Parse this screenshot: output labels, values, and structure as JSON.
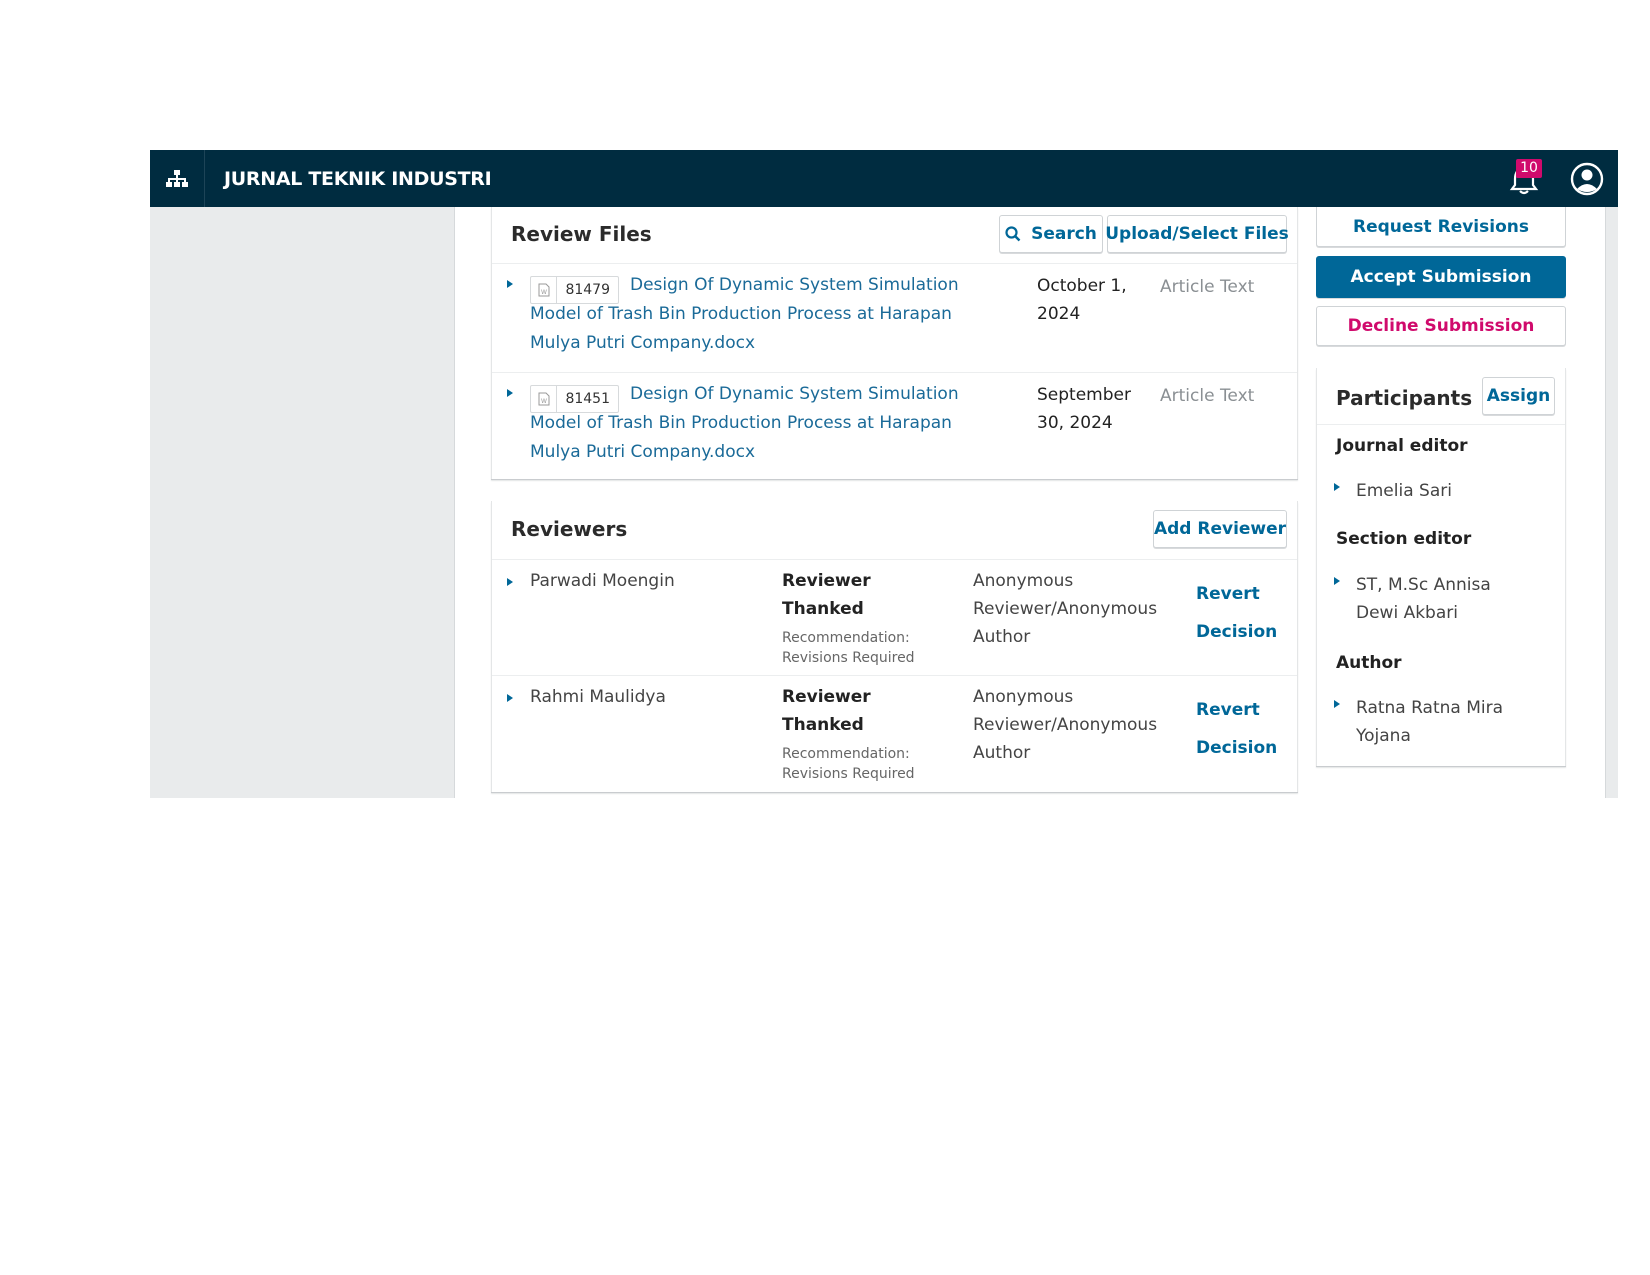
{
  "header": {
    "journal_title": "JURNAL TEKNIK INDUSTRI",
    "notification_count": "10"
  },
  "review_files": {
    "title": "Review Files",
    "search_label": "Search",
    "upload_label": "Upload/Select Files",
    "files": [
      {
        "id": "81479",
        "name": "Design Of Dynamic System Simulation Model of Trash Bin Production Process at Harapan Mulya Putri Company.docx",
        "date": "October 1, 2024",
        "type": "Article Text"
      },
      {
        "id": "81451",
        "name": "Design Of Dynamic System Simulation Model of Trash Bin Production Process at Harapan Mulya Putri Company.docx",
        "date": "September 30, 2024",
        "type": "Article Text"
      }
    ]
  },
  "reviewers": {
    "title": "Reviewers",
    "add_label": "Add Reviewer",
    "rows": [
      {
        "name": "Parwadi Moengin",
        "status": "Reviewer Thanked",
        "recommendation": "Recommendation: Revisions Required",
        "method": "Anonymous Reviewer/Anonymous Author",
        "action": "Revert Decision"
      },
      {
        "name": "Rahmi Maulidya",
        "status": "Reviewer Thanked",
        "recommendation": "Recommendation: Revisions Required",
        "method": "Anonymous Reviewer/Anonymous Author",
        "action": "Revert Decision"
      }
    ]
  },
  "decisions": {
    "request_revisions": "Request Revisions",
    "accept": "Accept Submission",
    "decline": "Decline Submission"
  },
  "participants": {
    "title": "Participants",
    "assign_label": "Assign",
    "groups": [
      {
        "role": "Journal editor",
        "members": [
          "Emelia Sari"
        ]
      },
      {
        "role": "Section editor",
        "members": [
          "ST, M.Sc Annisa Dewi Akbari"
        ]
      },
      {
        "role": "Author",
        "members": [
          "Ratna Ratna Mira Yojana"
        ]
      }
    ]
  },
  "colors": {
    "header_bg": "#002c40",
    "primary": "#006798",
    "danger": "#d00a6c"
  },
  "icons": [
    "sitemap-icon",
    "bell-icon",
    "user-icon",
    "search-icon",
    "doc-icon",
    "caret-right-icon"
  ]
}
